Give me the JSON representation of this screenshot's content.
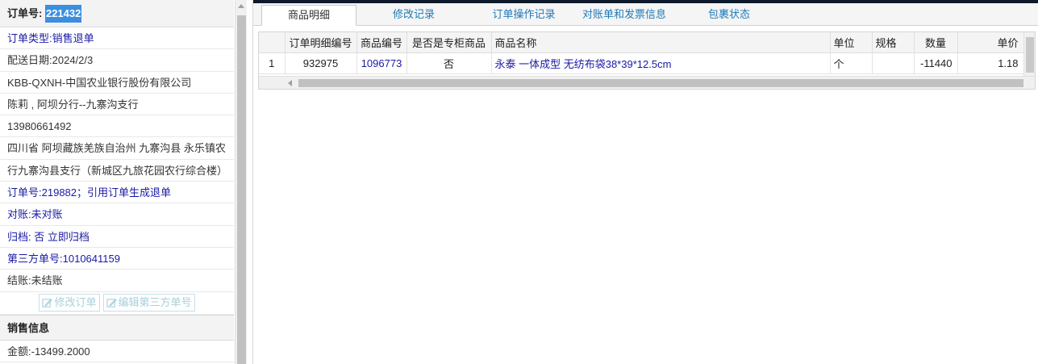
{
  "left": {
    "order_no_label": "订单号:",
    "order_no_value": "221432",
    "rows": [
      {
        "label": "订单类型:",
        "value": "销售退单",
        "style": "blue"
      },
      {
        "label": "配送日期:",
        "value": "2024/2/3",
        "style": "dark"
      },
      {
        "label": "",
        "value": "KBB-QXNH-中国农业银行股份有限公司",
        "style": "dark"
      },
      {
        "label": "",
        "value": "陈莉 , 阿坝分行--九寨沟支行",
        "style": "dark"
      },
      {
        "label": "",
        "value": "13980661492",
        "style": "dark"
      },
      {
        "label": "",
        "value": "四川省 阿坝藏族羌族自治州 九寨沟县 永乐镇农",
        "style": "dark"
      },
      {
        "label": "",
        "value": "行九寨沟县支行（新城区九旅花园农行综合楼）",
        "style": "dark"
      },
      {
        "label": "订单号:",
        "value": "219882；引用订单生成退单",
        "style": "blue"
      },
      {
        "label": "对账:",
        "value": "未对账",
        "style": "blue"
      },
      {
        "label": "归档:",
        "value": " 否 立即归档",
        "style": "blue"
      },
      {
        "label": "第三方单号:",
        "value": "1010641159",
        "style": "blue"
      },
      {
        "label": "结账:",
        "value": "未结账",
        "style": "dark"
      }
    ],
    "buttons": {
      "edit_order": "修改订单",
      "edit_third": "编辑第三方单号"
    },
    "sales_section": "销售信息",
    "amount_label": "金额:",
    "amount_value": "-13499.2000"
  },
  "tabs": [
    {
      "label": "商品明细",
      "active": true
    },
    {
      "label": "修改记录",
      "active": false
    },
    {
      "label": "订单操作记录",
      "active": false
    },
    {
      "label": "对账单和发票信息",
      "active": false
    },
    {
      "label": "包裹状态",
      "active": false
    }
  ],
  "grid": {
    "headers": [
      "",
      "订单明细编号",
      "商品编号",
      "是否是专柜商品",
      "商品名称",
      "单位",
      "规格",
      "数量",
      "单价"
    ],
    "rows": [
      [
        "1",
        "932975",
        "1096773",
        "否",
        "永泰 一体成型 无纺布袋38*39*12.5cm",
        "个",
        "",
        "-11440",
        "1.18"
      ]
    ]
  }
}
